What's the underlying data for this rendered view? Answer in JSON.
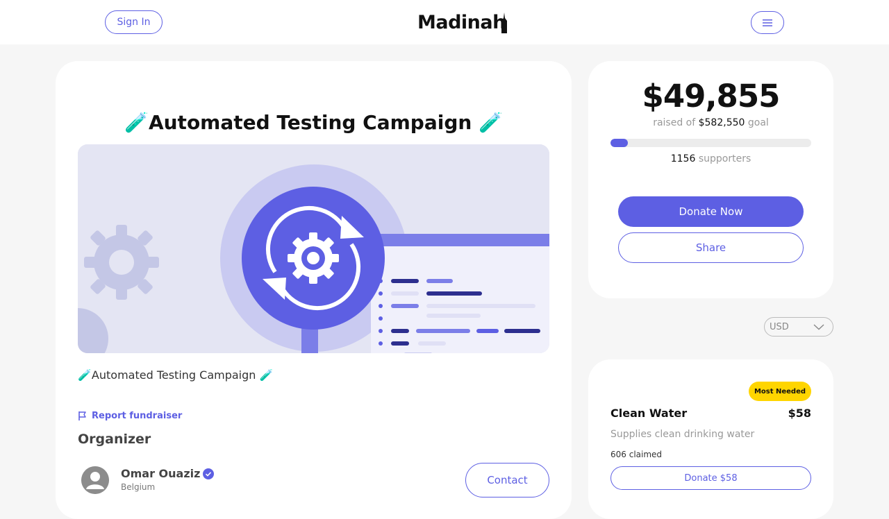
{
  "header": {
    "sign_in_label": "Sign In",
    "logo_text": "Madinah",
    "menu_icon": "hamburger-menu-icon"
  },
  "campaign": {
    "title": "🧪Automated Testing Campaign 🧪",
    "subtitle": "🧪Automated Testing Campaign 🧪",
    "hero_image": "automated-testing-illustration"
  },
  "report": {
    "label": "Report fundraiser",
    "icon": "flag-icon"
  },
  "organizer": {
    "heading": "Organizer",
    "name": "Omar Ouaziz",
    "location": "Belgium",
    "verified_icon": "verified-check-icon",
    "contact_label": "Contact"
  },
  "donation": {
    "raised": "$49,855",
    "raised_prefix": "raised of",
    "goal": "$582,550",
    "goal_suffix": "goal",
    "progress_fraction": 0.086,
    "supporters_count": "1156",
    "supporters_label": "supporters",
    "donate_label": "Donate Now",
    "share_label": "Share"
  },
  "currency": {
    "selected": "USD"
  },
  "gift": {
    "badge": "Most Needed",
    "title": "Clean Water",
    "price": "$58",
    "description": "Supplies clean drinking water",
    "claimed": "606 claimed",
    "donate_label": "Donate $58"
  },
  "colors": {
    "accent": "#5d5fe3",
    "badge": "#ffd500",
    "page_bg": "#f6f6f6"
  }
}
